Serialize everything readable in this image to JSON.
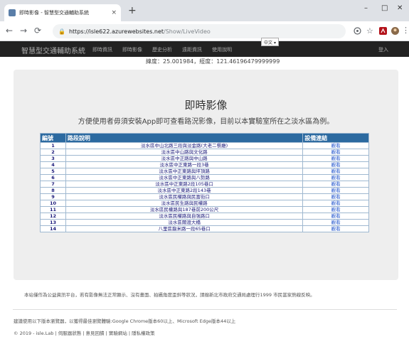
{
  "browser": {
    "tab_title": "即時影像 - 智慧型交通輔助系統",
    "tab_close": "×",
    "new_tab": "+",
    "window_controls": {
      "minimize": "–",
      "maximize": "□",
      "close": "✕"
    },
    "url_host": "https://isle622.azurewebsites.net",
    "url_path": "/Show/LiveVideo"
  },
  "site_nav": {
    "brand": "智慧型交通輔助系統",
    "links": [
      "即時資訊",
      "即時影像",
      "歷史分析",
      "遠距資訊",
      "使用說明"
    ],
    "language": "中文",
    "login": "登入"
  },
  "coords": "緯度：25.001984，經度：121.46196479999999",
  "main": {
    "title": "即時影像",
    "subtitle": "方便使用者毋須安裝App即可查看路況影像，目前以本實驗室所在之淡水區為例。"
  },
  "table": {
    "headers": [
      "編號",
      "路段說明",
      "設備連結"
    ],
    "rows": [
      {
        "no": "1",
        "desc": "淡水區中山北路三段與淡金路(大老二餐廳)",
        "link": "觀看"
      },
      {
        "no": "2",
        "desc": "淡水區中山路與文化路",
        "link": "觀看"
      },
      {
        "no": "3",
        "desc": "淡水區中正路與中山路",
        "link": "觀看"
      },
      {
        "no": "4",
        "desc": "淡水區中正東路一段3巷",
        "link": "觀看"
      },
      {
        "no": "5",
        "desc": "淡水區中正東路與坪頂路",
        "link": "觀看"
      },
      {
        "no": "6",
        "desc": "淡水區中正東路與八勢路",
        "link": "觀看"
      },
      {
        "no": "7",
        "desc": "淡水區中正東路2段105巷口",
        "link": "觀看"
      },
      {
        "no": "8",
        "desc": "淡水區中正東路2段143巷",
        "link": "觀看"
      },
      {
        "no": "9",
        "desc": "淡水區民權路與民富街口",
        "link": "觀看"
      },
      {
        "no": "10",
        "desc": "淡水區民生路與民權路",
        "link": "觀看"
      },
      {
        "no": "11",
        "desc": "淡水區民權路與187巷前200公尺",
        "link": "觀看"
      },
      {
        "no": "12",
        "desc": "淡水區民權路與自強路口",
        "link": "觀看"
      },
      {
        "no": "13",
        "desc": "淡水區關渡大橋",
        "link": "觀看"
      },
      {
        "no": "14",
        "desc": "八里區龍米路一段65巷口",
        "link": "觀看"
      }
    ]
  },
  "footer": {
    "notice": "本站僅作為公益資訊平台，若有影像無法正常顯示、沒有畫面、拍攝角度歪斜等狀況，請撥新北市政府交通局處理行1999 市民當家熱線反映。",
    "browser_note": "建議使用以下版本瀏覽器，以獲得最佳瀏覽體驗:Google Chrome版本60以上、Microsoft Edge版本44以上",
    "copyright": "© 2019 - isle.Lab | 伺服器狀態 | 意見回饋 | 實驗網站 | 隱私權政策"
  }
}
